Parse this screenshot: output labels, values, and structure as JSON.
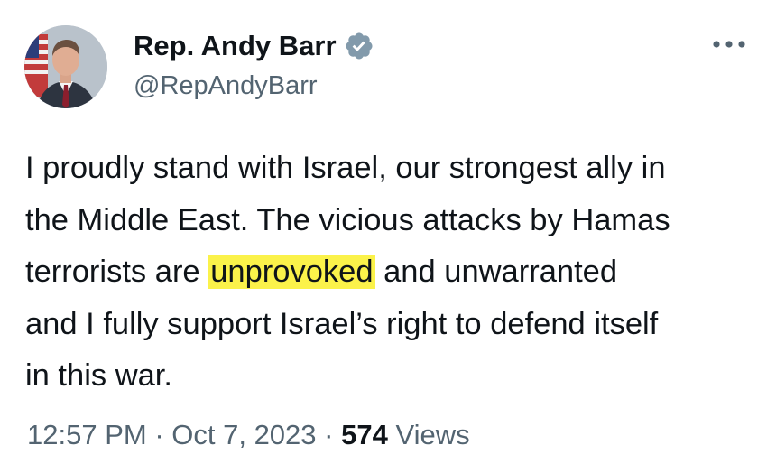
{
  "author": {
    "display_name": "Rep. Andy Barr",
    "handle": "@RepAndyBarr"
  },
  "more_icon": "more-horizontal-icon",
  "verified_icon": "verified-badge-icon",
  "verified_color": "#829aab",
  "tweet": {
    "line1": "I proudly stand with Israel, our strongest ally in",
    "line2": "the Middle East. The vicious attacks by Hamas",
    "line3_before": "terrorists are ",
    "line3_highlight": "unprovoked",
    "line3_after": " and unwarranted",
    "line4": "and I fully support Israel’s right to defend itself",
    "line5": "in this war."
  },
  "highlight_color": "#fbf24a",
  "meta": {
    "time": "12:57 PM",
    "sep1": " · ",
    "date": "Oct 7, 2023",
    "sep2": " · ",
    "views_count": "574",
    "views_label": " Views"
  }
}
